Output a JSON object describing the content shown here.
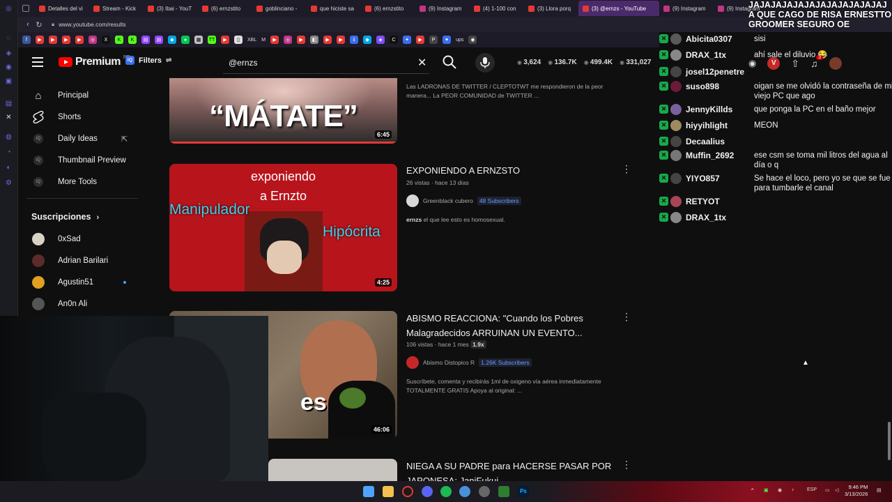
{
  "browser": {
    "tabs": [
      {
        "label": "Detalles del vi",
        "color": "#e53935"
      },
      {
        "label": "Stream - Kick",
        "color": "#e53935"
      },
      {
        "label": "(3) Ibai - YouT",
        "color": "#e53935"
      },
      {
        "label": "(6) ernzstito",
        "color": "#e53935"
      },
      {
        "label": "goblinciano -",
        "color": "#e53935"
      },
      {
        "label": "que hiciste sa",
        "color": "#e53935"
      },
      {
        "label": "(6) ernzstito",
        "color": "#e53935"
      },
      {
        "label": "(9) Instagram",
        "color": "#c13584"
      },
      {
        "label": "(4) 1-100 con",
        "color": "#e53935"
      },
      {
        "label": "(3) Llora porq",
        "color": "#e53935"
      },
      {
        "label": "(3) @ernzs - YouTube",
        "color": "#e53935",
        "active": true
      },
      {
        "label": "(9) Instagram",
        "color": "#c13584"
      },
      {
        "label": "(9) Instagram",
        "color": "#c13584"
      }
    ],
    "url": "www.youtube.com/results",
    "bookmarks": {
      "labels": [
        "XBL",
        "M",
        "ups",
        "ext"
      ]
    }
  },
  "youtube": {
    "logo_text": "Premium",
    "logo_region": "PE",
    "filters_label": "Filters",
    "search_value": "@ernzs",
    "stats": [
      "3,624",
      "136.7K",
      "499.4K",
      "331,027"
    ],
    "notif_count": "3",
    "sidebar": {
      "items": [
        {
          "label": "Principal",
          "icon": "home-icon"
        },
        {
          "label": "Shorts",
          "icon": "shorts-icon"
        },
        {
          "label": "Daily Ideas",
          "icon": "iq-icon"
        },
        {
          "label": "Thumbnail Preview",
          "icon": "iq-icon"
        },
        {
          "label": "More Tools",
          "icon": "iq-icon"
        }
      ],
      "subs_title": "Suscripciones",
      "subs": [
        {
          "name": "0xSad",
          "color": "#d9d2c4"
        },
        {
          "name": "Adrian Barilari",
          "color": "#5c2b2b"
        },
        {
          "name": "Agustin51",
          "color": "#e0a020"
        },
        {
          "name": "An0n Ali",
          "color": "#555"
        }
      ]
    },
    "results": [
      {
        "thumb_text": "“MÁTATE”",
        "duration": "6:45",
        "desc": "Las LADRONAS DE TWITTER / CLEPTOTWT me respondieron de la peor manera... La PEOR COMUNIDAD de TWITTER ..."
      },
      {
        "title": "EXPONIENDO A ERNZSTO",
        "meta": "26 vistas · hace 13 días",
        "channel": "Greenblack cubero",
        "subs_badge": "48 Subscribers",
        "desc_bold": "ernzs",
        "desc": " el que lee esto es homosexual.",
        "thumb_top": "exponiendo",
        "thumb_top2": "a Ernzto",
        "thumb_left": "Manipulador",
        "thumb_right": "Hipócrita",
        "duration": "4:25"
      },
      {
        "title": "ABISMO REACCIONA: \"Cuando los Pobres Malagradecidos ARRUINAN UN EVENTO...",
        "meta": "106 vistas · hace 1 mes",
        "speed": "1.9x",
        "channel": "Abismo Distopico R",
        "subs_badge": "1.26K Subscribers",
        "desc": "Suscríbete, comenta y recibirás 1ml de oxigeno vía aérea inmediatamente TOTALMENTE GRATIS Apoya al original: ...",
        "thumb_text": "es",
        "duration": "46:06"
      },
      {
        "title": "NIEGA A SU PADRE para HACERSE PASAR POR JAPONESA: JaniFukui"
      }
    ]
  },
  "chat": {
    "top_message": "JAJAJAJAJAJAJAJAJAJAJAJAJ A QUE CAGO DE RISA ERNESTTO GROOMER SEGURO OE",
    "rows": [
      {
        "user": "Abicita0307",
        "msg": "sisi",
        "color": "#5a5a5a"
      },
      {
        "user": "DRAX_1tx",
        "msg": "ahí sale el diluvio 😂",
        "color": "#888"
      },
      {
        "user": "josel12penetre",
        "msg": "",
        "color": "#444"
      },
      {
        "user": "suso898",
        "msg": "oigan se me olvidó la contraseña de mi viejo PC que ago",
        "color": "#6b1a3a"
      },
      {
        "user": "JennyKillds",
        "msg": "que ponga la PC en el baño mejor",
        "color": "#7a5fa0"
      },
      {
        "user": "hiyyihlight",
        "msg": "MEON",
        "color": "#a08a60"
      },
      {
        "user": "Decaalius",
        "msg": "",
        "color": "#444"
      },
      {
        "user": "Muffin_2692",
        "msg": "ese csm se toma mil litros del agua al día o q",
        "color": "#777"
      },
      {
        "user": "YIYO857",
        "msg": "Se hace el loco, pero yo se que se fue para tumbarle el canal",
        "color": "#444"
      },
      {
        "user": "RETYOT",
        "msg": "",
        "color": "#aa4455"
      },
      {
        "user": "DRAX_1tx",
        "msg": "",
        "color": "#888"
      }
    ]
  },
  "taskbar": {
    "lang": "ESP",
    "time": "9:46 PM",
    "date": "3/13/2026"
  }
}
